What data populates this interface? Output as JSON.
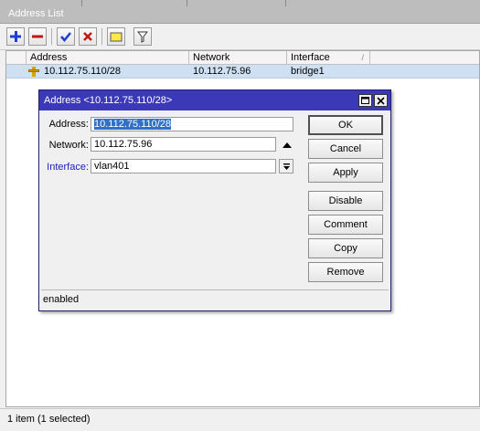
{
  "list_window": {
    "title": "Address List",
    "toolbar": {
      "add": "plus-icon",
      "remove": "minus-icon",
      "enable": "checkmark-icon",
      "disable": "cross-icon",
      "comment": "note-icon",
      "filter": "filter-icon"
    },
    "columns": [
      "Address",
      "Network",
      "Interface"
    ],
    "rows": [
      {
        "address": "10.112.75.110/28",
        "network": "10.112.75.96",
        "interface": "bridge1"
      }
    ],
    "status": "1 item (1 selected)"
  },
  "dialog": {
    "title": "Address <10.112.75.110/28>",
    "fields": {
      "address_label": "Address:",
      "address_value": "10.112.75.110/28",
      "network_label": "Network:",
      "network_value": "10.112.75.96",
      "interface_label": "Interface:",
      "interface_value": "vlan401"
    },
    "buttons": {
      "ok": "OK",
      "cancel": "Cancel",
      "apply": "Apply",
      "disable": "Disable",
      "comment": "Comment",
      "copy": "Copy",
      "remove": "Remove"
    },
    "status": "enabled"
  },
  "colors": {
    "dialog_title": "#3c39b8",
    "selection": "#cfe0f2",
    "interface_label": "#2020c0"
  }
}
